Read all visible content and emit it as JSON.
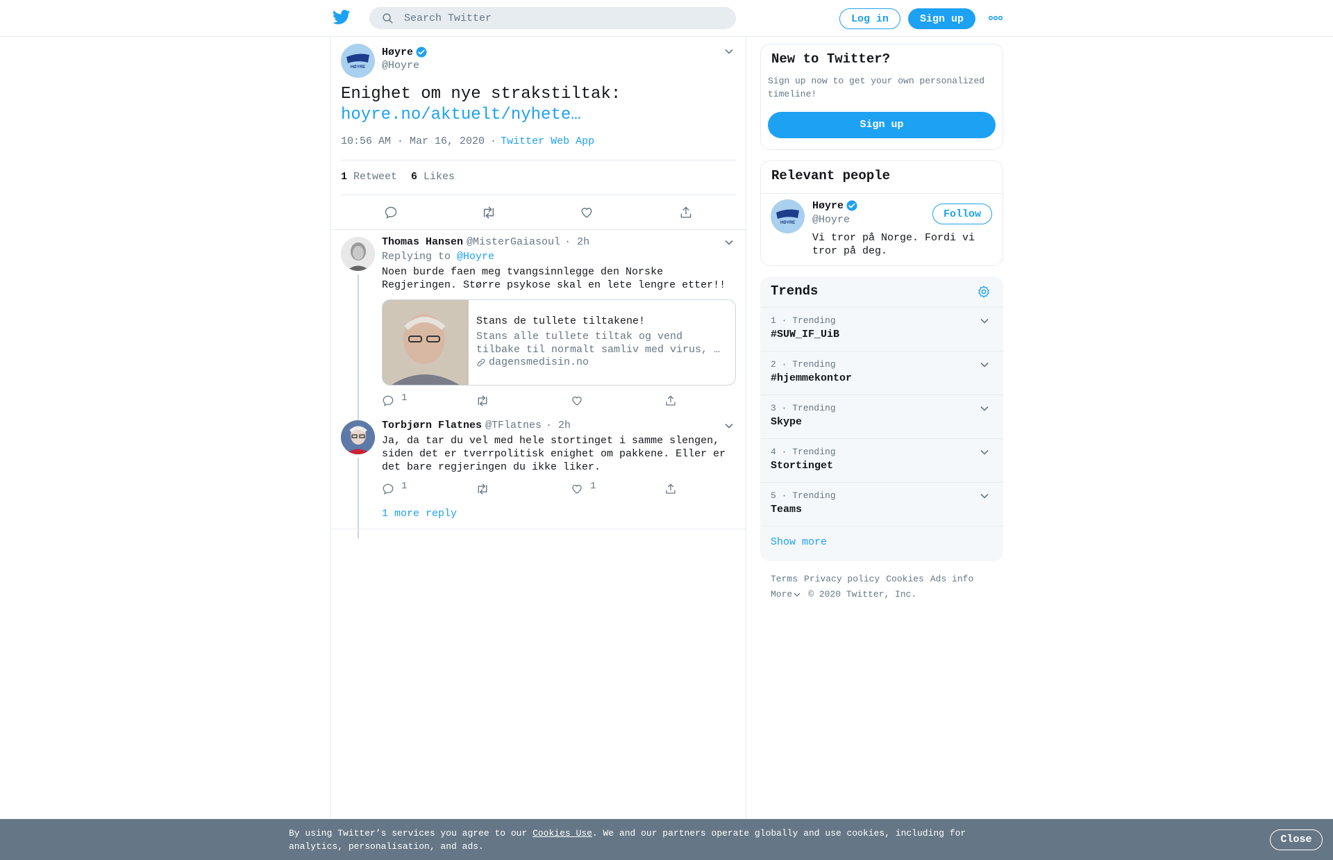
{
  "header": {
    "search_placeholder": "Search Twitter",
    "login_label": "Log in",
    "signup_label": "Sign up"
  },
  "tweet": {
    "author_name": "Høyre",
    "author_handle": "@Hoyre",
    "text": "Enighet om nye strakstiltak:",
    "link": "hoyre.no/aktuelt/nyhete…",
    "timestamp": "10:56 AM · Mar 16, 2020",
    "source_sep": "·",
    "source": "Twitter Web App",
    "retweet_count": "1",
    "retweet_label": "Retweet",
    "like_count": "6",
    "like_label": "Likes",
    "avatar_text": "HØYRE"
  },
  "replies": [
    {
      "name": "Thomas Hansen",
      "handle": "@MisterGaiasoul",
      "time": "· 2h",
      "replying_prefix": "Replying to",
      "replying_to": "@Hoyre",
      "text": "Noen burde faen meg tvangsinnlegge den Norske Regjeringen. Større psykose skal en lete lengre etter!!",
      "card_title": "Stans de tullete tiltakene!",
      "card_desc": "Stans alle tullete tiltak og vend tilbake til normalt samliv med virus, …",
      "card_domain": "dagensmedisin.no",
      "reply_count": "1",
      "like_count": ""
    },
    {
      "name": "Torbjørn Flatnes",
      "handle": "@TFlatnes",
      "time": "· 2h",
      "text": "Ja, da tar du vel med hele stortinget i samme slengen, siden det er tverrpolitisk enighet om pakkene. Eller er det bare regjeringen du ikke liker.",
      "reply_count": "1",
      "like_count": "1"
    }
  ],
  "more_replies": "1 more reply",
  "sidebar": {
    "new_title": "New to Twitter?",
    "new_desc": "Sign up now to get your own personalized timeline!",
    "signup_label": "Sign up",
    "relevant_title": "Relevant people",
    "person_name": "Høyre",
    "person_handle": "@Hoyre",
    "person_bio": "Vi tror på Norge. Fordi vi tror på deg.",
    "follow_label": "Follow",
    "trends_title": "Trends",
    "trends": [
      {
        "meta": "1 · Trending",
        "name": "#SUW_IF_UiB"
      },
      {
        "meta": "2 · Trending",
        "name": "#hjemmekontor"
      },
      {
        "meta": "3 · Trending",
        "name": "Skype"
      },
      {
        "meta": "4 · Trending",
        "name": "Stortinget"
      },
      {
        "meta": "5 · Trending",
        "name": "Teams"
      }
    ],
    "show_more": "Show more"
  },
  "footer": {
    "links": [
      "Terms",
      "Privacy policy",
      "Cookies",
      "Ads info"
    ],
    "more": "More",
    "copyright": "© 2020 Twitter, Inc."
  },
  "cookie": {
    "prefix": "By using Twitter’s services you agree to our ",
    "link": "Cookies Use",
    "suffix": ". We and our partners operate globally and use cookies, including for analytics, personalisation, and ads.",
    "close_label": "Close"
  },
  "colors": {
    "accent": "#1da1f2",
    "muted": "#657786",
    "border": "#e6ecf0"
  }
}
